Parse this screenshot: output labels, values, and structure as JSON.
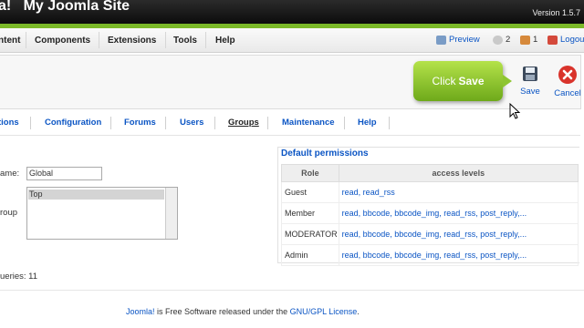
{
  "header": {
    "site_title": "a!   My Joomla Site",
    "version": "Version 1.5.7"
  },
  "menu": [
    "ntent",
    "Components",
    "Extensions",
    "Tools",
    "Help"
  ],
  "status": {
    "preview": "Preview",
    "messages": "2",
    "users": "1",
    "logout": "Logout"
  },
  "toolbar": {
    "save": "Save",
    "cancel": "Cancel"
  },
  "callout": {
    "prefix": "Click",
    "emph": "Save"
  },
  "subnav": [
    "tions",
    "Configuration",
    "Forums",
    "Users",
    "Groups",
    "Maintenance",
    "Help"
  ],
  "form": {
    "name_label": "ame:",
    "name_value": "Global",
    "group_label": "roup",
    "group_option": "Top"
  },
  "permissions": {
    "title": "Default permissions",
    "col_role": "Role",
    "col_levels": "access levels",
    "rows": [
      {
        "role": "Guest",
        "levels": "read, read_rss"
      },
      {
        "role": "Member",
        "levels": "read, bbcode, bbcode_img, read_rss, post_reply,..."
      },
      {
        "role": "MODERATOR",
        "levels": "read, bbcode, bbcode_img, read_rss, post_reply,..."
      },
      {
        "role": "Admin",
        "levels": "read, bbcode, bbcode_img, read_rss, post_reply,..."
      }
    ]
  },
  "queries": "ueries: 11",
  "footer": {
    "joomla": "Joomla!",
    "middle": " is Free Software released under the ",
    "license": "GNU/GPL License",
    "end": "."
  },
  "colors": {
    "accent": "#0b55c4",
    "green": "#7bb928",
    "callout": "#8ec531"
  }
}
